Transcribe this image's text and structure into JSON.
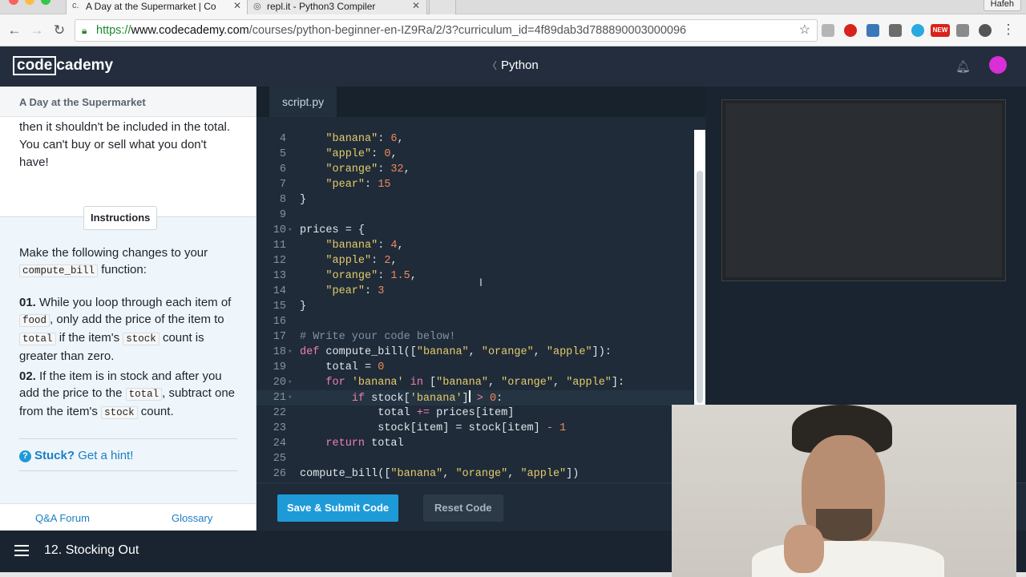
{
  "browser": {
    "tabs": [
      {
        "title": "A Day at the Supermarket | Co",
        "active": true
      },
      {
        "title": "repl.it - Python3 Compiler",
        "active": false
      }
    ],
    "profile": "Hafeh",
    "url": {
      "scheme": "https://",
      "host": "www.codecademy.com",
      "path": "/courses/python-beginner-en-IZ9Ra/2/3?curriculum_id=4f89dab3d788890003000096"
    },
    "extension_badge": "NEW"
  },
  "header": {
    "logo_code": "code",
    "logo_academy": "cademy",
    "course": "Python"
  },
  "lesson": {
    "title": "A Day at the Supermarket",
    "narrative": "then it shouldn't be included in the total. You can't buy or sell what you don't have!",
    "instructions_label": "Instructions",
    "intro_before": "Make the following changes to your",
    "intro_code": "compute_bill",
    "intro_after": "function:",
    "step1": {
      "num": "01.",
      "t1": "While you loop through each item of",
      "c1": "food",
      "t2": ", only add the price of the item to",
      "c2": "total",
      "t3": "if the item's",
      "c3": "stock",
      "t4": "count is greater than zero."
    },
    "step2": {
      "num": "02.",
      "t1": "If the item is in stock and after you add the price to the",
      "c1": "total",
      "t2": ", subtract one from the item's",
      "c2": "stock",
      "t3": "count."
    },
    "stuck": "Stuck?",
    "hint": "Get a hint!",
    "footer_forum": "Q&A Forum",
    "footer_glossary": "Glossary"
  },
  "editor": {
    "file_tab": "script.py",
    "submit": "Save & Submit Code",
    "reset": "Reset Code"
  },
  "bottom": {
    "lesson_nav": "12. Stocking Out"
  },
  "colors": {
    "accent": "#1e9bd7",
    "header_bg": "#232d3d",
    "editor_bg": "#1f2b38"
  }
}
